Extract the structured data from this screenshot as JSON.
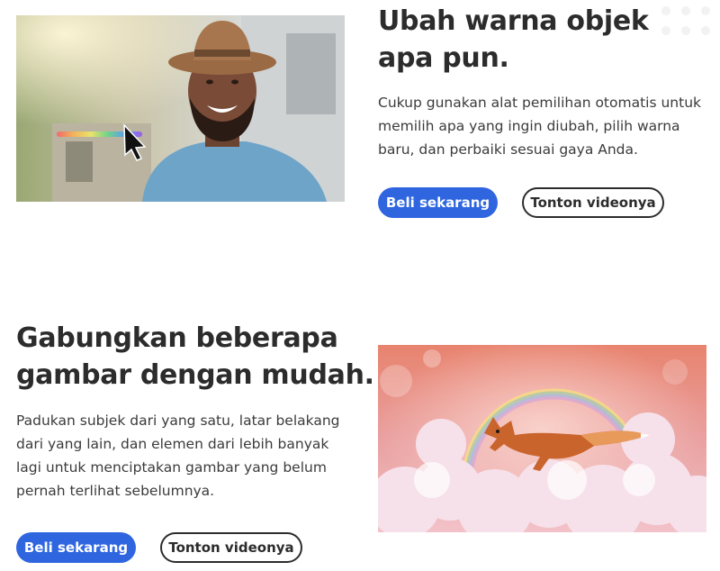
{
  "section1": {
    "heading": "Ubah warna objek apa pun.",
    "body": "Cukup gunakan alat pemilihan otomatis untuk memilih apa yang ingin diubah, pilih warna baru, dan perbaiki sesuai gaya Anda.",
    "buy_label": "Beli sekarang",
    "video_label": "Tonton videonya"
  },
  "section2": {
    "heading": "Gabungkan beberapa gambar dengan mudah.",
    "body": "Padukan subjek dari yang satu, latar belakang dari yang lain, dan elemen dari lebih banyak lagi untuk menciptakan gambar yang belum pernah terlihat sebelumnya.",
    "buy_label": "Beli sekarang",
    "video_label": "Tonton videonya"
  },
  "colors": {
    "primary_button": "#2f66e0",
    "text": "#2c2c2c"
  },
  "icons": [
    "cursor-arrow-icon",
    "color-slider"
  ]
}
